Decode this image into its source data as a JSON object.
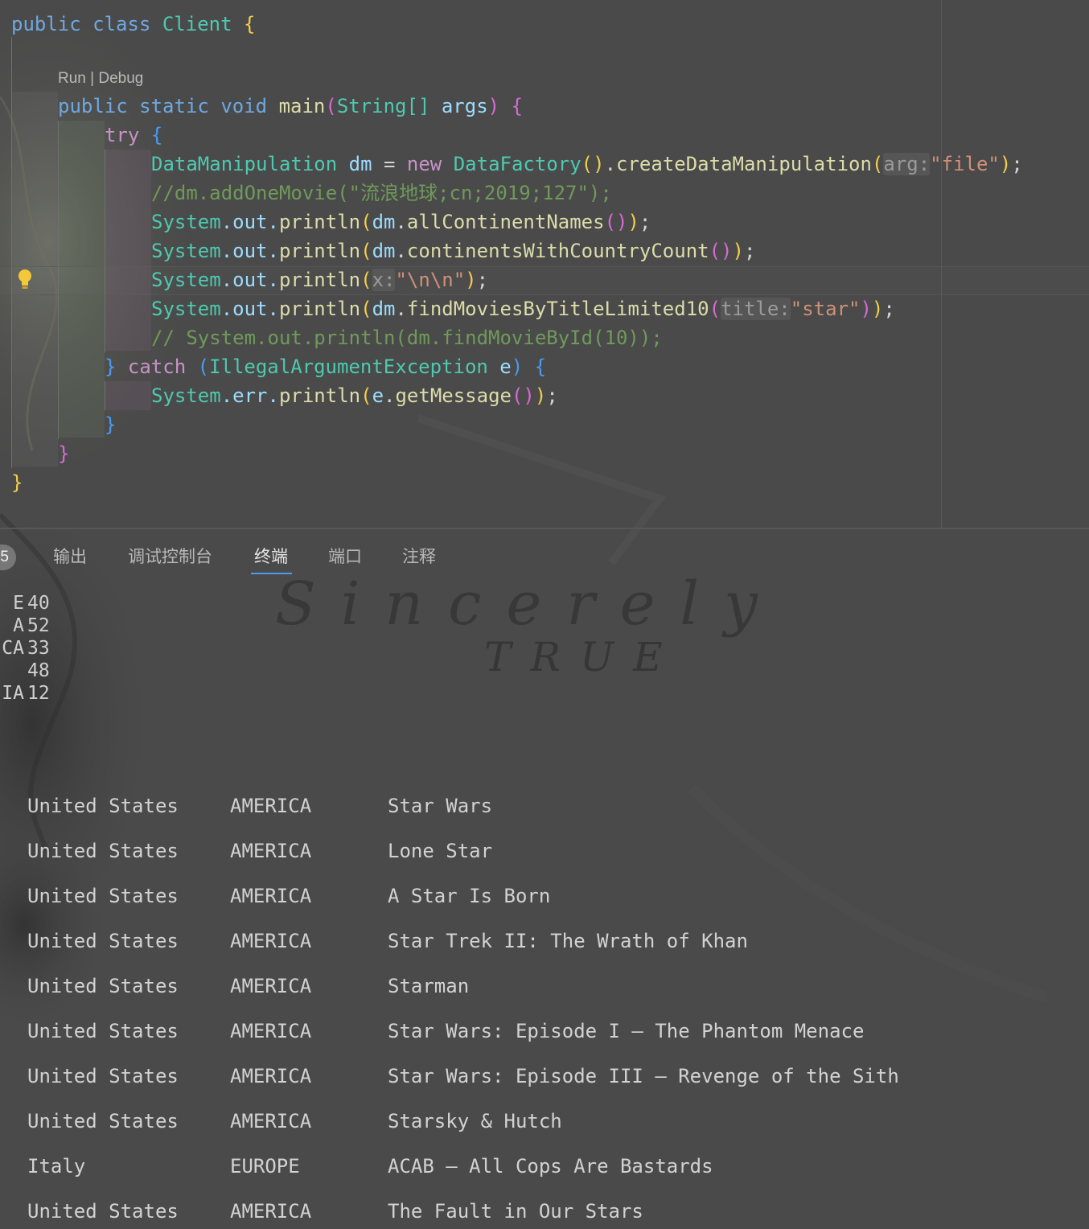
{
  "editor": {
    "codelens": "Run | Debug",
    "lines": {
      "l1": {
        "public": "public",
        "class": "class",
        "name": "Client",
        "brace": "{"
      },
      "l3": {
        "public": "public",
        "static": "static",
        "void": "void",
        "main": "main",
        "paren_open": "(",
        "string_arr": "String[]",
        "args": "args",
        "paren_close": ")",
        "brace": "{"
      },
      "l4": {
        "try": "try",
        "brace": "{"
      },
      "l5": {
        "type": "DataManipulation",
        "var": "dm",
        "eq": " = ",
        "new": "new",
        "factory": "DataFactory",
        "call": "()",
        "dot": ".",
        "method": "createDataManipulation",
        "po": "(",
        "hint": "arg:",
        "str": "\"file\"",
        "pc": ")",
        "semi": ";"
      },
      "l6": {
        "comment": "//dm.addOneMovie(\"流浪地球;cn;2019;127\");"
      },
      "l7": {
        "sys": "System",
        "out": ".out.",
        "println": "println",
        "po": "(",
        "dm": "dm",
        "dot": ".",
        "method": "allContinentNames",
        "call": "()",
        "pc": ")",
        "semi": ";"
      },
      "l8": {
        "sys": "System",
        "out": ".out.",
        "println": "println",
        "po": "(",
        "dm": "dm",
        "dot": ".",
        "method": "continentsWithCountryCount",
        "call": "()",
        "pc": ")",
        "semi": ";"
      },
      "l9": {
        "sys": "System",
        "out": ".out.",
        "println": "println",
        "po": "(",
        "hint": "x:",
        "str": "\"\\n\\n\"",
        "pc": ")",
        "semi": ";"
      },
      "l10": {
        "sys": "System",
        "out": ".out.",
        "println": "println",
        "po": "(",
        "dm": "dm",
        "dot": ".",
        "method": "findMoviesByTitleLimited10",
        "po2": "(",
        "hint": "title:",
        "str": "\"star\"",
        "pc2": ")",
        "pc": ")",
        "semi": ";"
      },
      "l11": {
        "comment": "// System.out.println(dm.findMovieById(10));"
      },
      "l12": {
        "close": "}",
        "catch": "catch",
        "po": "(",
        "type": "IllegalArgumentException",
        "var": "e",
        "pc": ")",
        "brace": "{"
      },
      "l13": {
        "sys": "System",
        "err": ".err.",
        "println": "println",
        "po": "(",
        "e": "e",
        "dot": ".",
        "method": "getMessage",
        "call": "()",
        "pc": ")",
        "semi": ";"
      },
      "l14": {
        "close": "}"
      },
      "l15": {
        "close": "}"
      },
      "l16": {
        "close": "}"
      }
    }
  },
  "panel": {
    "badge": "5",
    "tabs": [
      "输出",
      "调试控制台",
      "终端",
      "端口",
      "注释"
    ],
    "active_tab": "终端",
    "watermark": {
      "line1": "Sincerely",
      "line2": "TRUE"
    },
    "continent_counts": [
      {
        "label": "E",
        "count": "40"
      },
      {
        "label": "A",
        "count": "52"
      },
      {
        "label": "CA",
        "count": "33"
      },
      {
        "label": "",
        "count": "48"
      },
      {
        "label": "IA",
        "count": "12"
      }
    ],
    "movies": [
      {
        "country": "United States",
        "continent": "AMERICA",
        "title": "Star Wars"
      },
      {
        "country": "United States",
        "continent": "AMERICA",
        "title": "Lone Star"
      },
      {
        "country": "United States",
        "continent": "AMERICA",
        "title": "A Star Is Born"
      },
      {
        "country": "United States",
        "continent": "AMERICA",
        "title": "Star Trek II: The Wrath of Khan"
      },
      {
        "country": "United States",
        "continent": "AMERICA",
        "title": "Starman"
      },
      {
        "country": "United States",
        "continent": "AMERICA",
        "title": "Star Wars: Episode I – The Phantom Menace"
      },
      {
        "country": "United States",
        "continent": "AMERICA",
        "title": "Star Wars: Episode III – Revenge of the Sith"
      },
      {
        "country": "United States",
        "continent": "AMERICA",
        "title": "Starsky & Hutch"
      },
      {
        "country": "Italy",
        "continent": "EUROPE",
        "title": "ACAB – All Cops Are Bastards"
      },
      {
        "country": "United States",
        "continent": "AMERICA",
        "title": "The Fault in Our Stars"
      }
    ]
  }
}
